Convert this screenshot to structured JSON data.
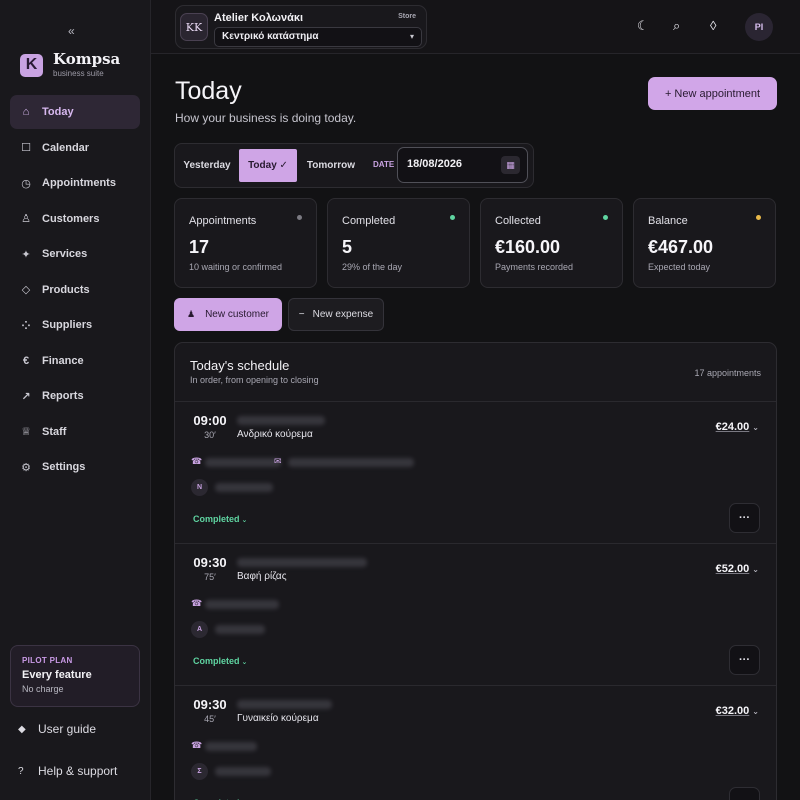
{
  "sidebar": {
    "collapse": "«",
    "brand": {
      "logo": "K",
      "name": "Kompsa",
      "sub": "business suite"
    },
    "items": [
      {
        "label": "Today",
        "icon": "⌂",
        "icon_name": "home-icon"
      },
      {
        "label": "Calendar",
        "icon": "☐",
        "icon_name": "calendar-icon"
      },
      {
        "label": "Appointments",
        "icon": "◷",
        "icon_name": "clock-icon"
      },
      {
        "label": "Customers",
        "icon": "♙",
        "icon_name": "person-icon"
      },
      {
        "label": "Services",
        "icon": "✦",
        "icon_name": "sparkle-icon"
      },
      {
        "label": "Products",
        "icon": "◇",
        "icon_name": "box-icon"
      },
      {
        "label": "Suppliers",
        "icon": "⁘",
        "icon_name": "users-icon"
      },
      {
        "label": "Finance",
        "icon": "€",
        "icon_name": "euro-icon"
      },
      {
        "label": "Reports",
        "icon": "↗",
        "icon_name": "trend-icon"
      },
      {
        "label": "Staff",
        "icon": "♕",
        "icon_name": "staff-icon"
      },
      {
        "label": "Settings",
        "icon": "⚙",
        "icon_name": "gear-icon"
      }
    ],
    "plan": {
      "tag": "PILOT PLAN",
      "title": "Every feature",
      "sub": "No charge"
    },
    "guide": {
      "icon": "◆",
      "label": "User guide"
    },
    "help": {
      "icon": "?",
      "label": "Help & support"
    }
  },
  "topbar": {
    "store_avatar": "KK",
    "store_name": "Atelier Κολωνάκι",
    "store_tag": "Store",
    "branch": "Κεντρικό κατάστημα",
    "icons": {
      "theme": "☾",
      "search": "⌕",
      "tag": "◊"
    },
    "user_initials": "PI"
  },
  "page": {
    "title": "Today",
    "subtitle": "How your business is doing today.",
    "new_appointment": "+ New appointment"
  },
  "daybar": {
    "yesterday": "Yesterday",
    "today": "Today ✓",
    "tomorrow": "Tomorrow",
    "date_label": "DATE",
    "date_value": "18/08/2026",
    "date_icon": "▦"
  },
  "stats": [
    {
      "label": "Appointments",
      "value": "17",
      "sub": "10 waiting or confirmed",
      "dot": "#7b7a82"
    },
    {
      "label": "Completed",
      "value": "5",
      "sub": "29% of the day",
      "dot": "#5fd4a1"
    },
    {
      "label": "Collected",
      "value": "€160.00",
      "sub": "Payments recorded",
      "dot": "#5fd4a1"
    },
    {
      "label": "Balance",
      "value": "€467.00",
      "sub": "Expected today",
      "dot": "#e9b949"
    }
  ],
  "actions": {
    "new_customer": "New customer",
    "new_customer_icon": "♟",
    "new_expense": "New expense",
    "new_expense_icon": "−"
  },
  "schedule": {
    "title": "Today's schedule",
    "sub": "In order, from opening to closing",
    "count": "17 appointments",
    "appointments": [
      {
        "time": "09:00",
        "duration": "30′",
        "service": "Ανδρικό κούρεμα",
        "price": "€24.00",
        "staff_initial": "N",
        "status": "Completed"
      },
      {
        "time": "09:30",
        "duration": "75′",
        "service": "Βαφή ρίζας",
        "price": "€52.00",
        "staff_initial": "Α",
        "status": "Completed"
      },
      {
        "time": "09:30",
        "duration": "45′",
        "service": "Γυναικείο κούρεμα",
        "price": "€32.00",
        "staff_initial": "Σ",
        "status": "Completed"
      }
    ]
  },
  "glyphs": {
    "phone": "☎",
    "mail": "✉",
    "chevron": "⌄",
    "more": "···",
    "caret": "▾"
  }
}
